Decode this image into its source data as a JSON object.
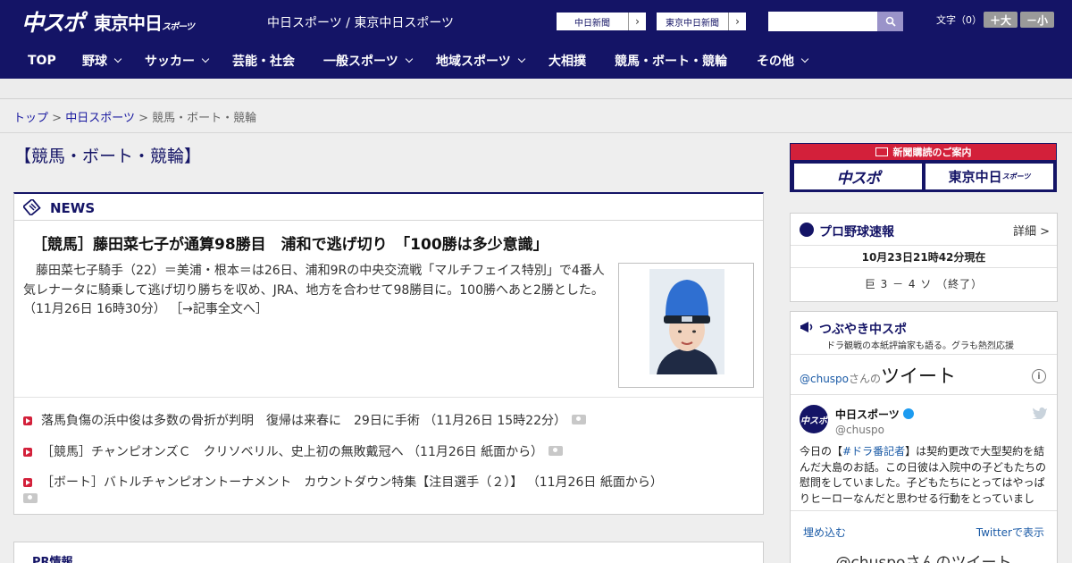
{
  "header": {
    "logo_main": "中スポ",
    "logo_tokyo": "東京中日",
    "logo_tokyo_small": "スポーツ",
    "site_name": "中日スポーツ / 東京中日スポーツ",
    "paper_links": [
      "中日新聞",
      "東京中日新聞"
    ],
    "search_placeholder": "",
    "font_size_label": "文字（0）",
    "font_larger": "＋大",
    "font_smaller": "－小"
  },
  "nav": {
    "items": [
      {
        "label": "TOP",
        "dropdown": false
      },
      {
        "label": "野球",
        "dropdown": true
      },
      {
        "label": "サッカー",
        "dropdown": true
      },
      {
        "label": "芸能・社会",
        "dropdown": false
      },
      {
        "label": "一般スポーツ",
        "dropdown": true
      },
      {
        "label": "地域スポーツ",
        "dropdown": true
      },
      {
        "label": "大相撲",
        "dropdown": false
      },
      {
        "label": "競馬・ボート・競輪",
        "dropdown": false
      },
      {
        "label": "その他",
        "dropdown": true
      }
    ]
  },
  "breadcrumb": {
    "items": [
      "トップ",
      "中日スポーツ"
    ],
    "separator": ">",
    "current": "競馬・ボート・競輪"
  },
  "page_title": "【競馬・ボート・競輪】",
  "news": {
    "heading": "NEWS",
    "lead": {
      "title": "［競馬］藤田菜七子が通算98勝目　浦和で逃げ切り　「100勝は多少意識」",
      "body": "藤田菜七子騎手（22）＝美浦・根本＝は26日、浦和9Rの中央交流戦「マルチフェイス特別」で4番人気レナータに騎乗して逃げ切り勝ちを収め、JRA、地方を合わせて98勝目に。100勝へあと2勝とした。（11月26日 16時30分）",
      "more": "［→記事全文へ］"
    },
    "items": [
      {
        "text": "落馬負傷の浜中俊は多数の骨折が判明　復帰は来春に　29日に手術",
        "date": "（11月26日 15時22分）",
        "photo": true
      },
      {
        "text": "［競馬］チャンピオンズＣ　クリソベリル、史上初の無敗戴冠へ",
        "date": "（11月26日 紙面から）",
        "photo": true
      },
      {
        "text": "［ボート］バトルチャンピオントーナメント　カウントダウン特集【注目選手（２）】",
        "date": "（11月26日 紙面から）",
        "photo": true
      }
    ]
  },
  "pr": {
    "heading": "PR情報"
  },
  "sidebar": {
    "subscription": {
      "top_label": "新聞購読のご案内",
      "buttons": [
        "中スポ",
        "東京中日"
      ],
      "button_small": "スポーツ"
    },
    "npb": {
      "title": "プロ野球速報",
      "more": "詳細 >",
      "time": "10月23日21時42分現在",
      "score": "巨 3 － 4 ソ （終了）"
    },
    "tweets": {
      "title": "つぶやき中スポ",
      "subtitle": "ドラ観戦の本紙評論家も語る。グラも熱烈応援",
      "widget_handle": "@chuspo",
      "widget_san": "さんの",
      "widget_tweet": "ツイート",
      "info": "i",
      "avatar_text": "中スポ",
      "account_name": "中日スポーツ",
      "account_handle": "@chuspo",
      "tweet_prefix": "今日の【",
      "tweet_tag": "#ドラ番記者",
      "tweet_body": "】は契約更改で大型契約を結んだ大島のお話。この日彼は入院中の子どもたちの慰問をしていました。子どもたちにとってはやっぱりヒーローなんだと思わせる行動をとっていまし",
      "embed": "埋め込む",
      "view_on": "Twitterで表示",
      "footer": "@chuspoさんのツイート"
    }
  },
  "colors": {
    "brand_navy": "#141466",
    "accent_red": "#d3203a",
    "link_blue": "#1a1aa0"
  }
}
